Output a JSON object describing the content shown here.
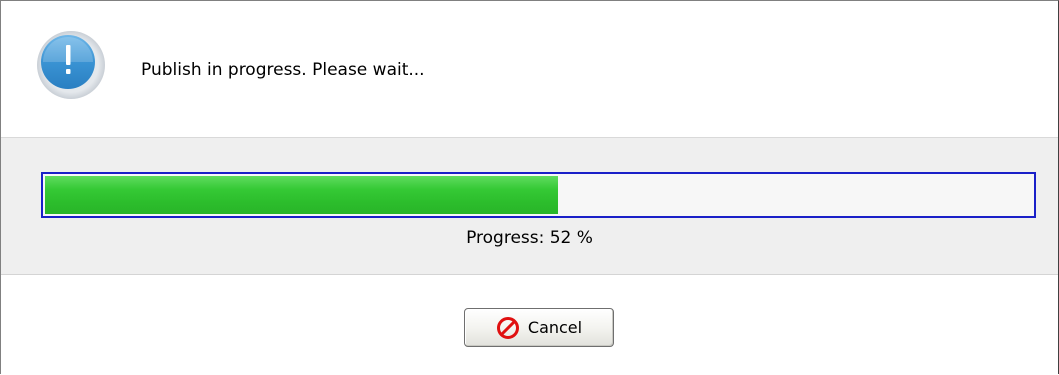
{
  "dialog": {
    "message": "Publish in progress. Please wait...",
    "icon": "info-exclamation-icon",
    "progress": {
      "percent": 52,
      "label": "Progress: 52 %",
      "fill_color": "#2ec42e",
      "border_color": "#1a20c8"
    },
    "cancel_button": {
      "label": "Cancel",
      "icon": "cancel-prohibited-icon"
    }
  }
}
